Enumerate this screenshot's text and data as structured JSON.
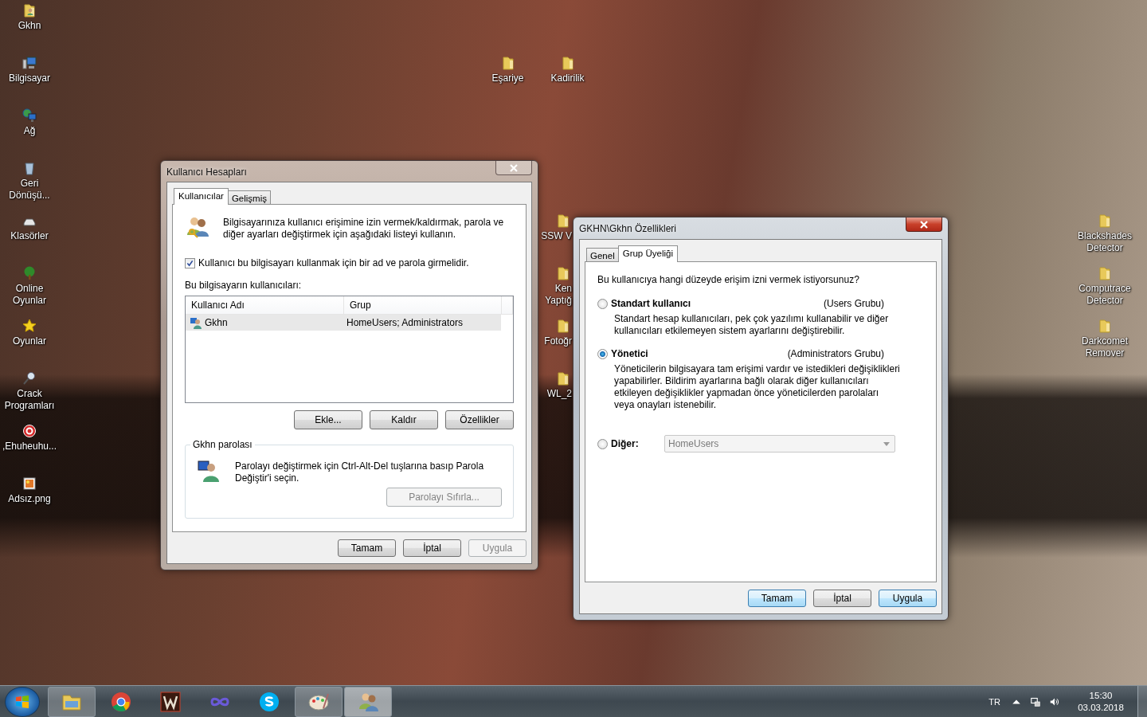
{
  "desktop": {
    "left_icons": [
      {
        "kind": "user-folder",
        "label": "Gkhn"
      },
      {
        "kind": "computer",
        "label": "Bilgisayar"
      },
      {
        "kind": "network",
        "label": "Ağ"
      },
      {
        "kind": "recycle-bin",
        "label": "Geri Dönüşü..."
      },
      {
        "kind": "drive",
        "label": "Klasörler"
      },
      {
        "kind": "tree",
        "label": "Online Oyunlar"
      },
      {
        "kind": "star",
        "label": "Oyunlar"
      },
      {
        "kind": "magnifier",
        "label": "Crack Programları"
      },
      {
        "kind": "red-badge",
        "label": ",Ehuheuhu..."
      },
      {
        "kind": "image",
        "label": "Adsız.png"
      }
    ],
    "top_icons": [
      {
        "kind": "folder",
        "label": "Eşariye"
      },
      {
        "kind": "folder",
        "label": "Kadirilik"
      }
    ],
    "partial_icons": [
      {
        "kind": "folder",
        "label": "SSW V"
      },
      {
        "kind": "folder",
        "label": "Ken Yaptığ"
      },
      {
        "kind": "folder",
        "label": "Fotoğr"
      },
      {
        "kind": "folder",
        "label": "WL_2"
      }
    ],
    "right_icons": [
      {
        "kind": "folder",
        "label": "Blackshades Detector"
      },
      {
        "kind": "folder",
        "label": "Computrace Detector"
      },
      {
        "kind": "folder",
        "label": "Darkcomet Remover"
      }
    ]
  },
  "users_window": {
    "title": "Kullanıcı Hesapları",
    "active": false,
    "tabs": [
      {
        "label": "Kullanıcılar",
        "selected": true
      },
      {
        "label": "Gelişmiş",
        "selected": false
      }
    ],
    "intro": "Bilgisayarınıza kullanıcı erişimine izin vermek/kaldırmak, parola ve diğer ayarları değiştirmek için aşağıdaki listeyi kullanın.",
    "require_password": {
      "label": "Kullanıcı bu bilgisayarı kullanmak için bir ad ve parola girmelidir.",
      "checked": true
    },
    "users_label": "Bu bilgisayarın kullanıcıları:",
    "columns": [
      "Kullanıcı Adı",
      "Grup"
    ],
    "rows": [
      {
        "name": "Gkhn",
        "group": "HomeUsers; Administrators",
        "selected": true
      }
    ],
    "list_buttons": [
      {
        "label": "Ekle...",
        "disabled": false
      },
      {
        "label": "Kaldır",
        "disabled": false
      },
      {
        "label": "Özellikler",
        "disabled": false
      }
    ],
    "password_group": {
      "title": "Gkhn parolası",
      "text": "Parolayı değiştirmek için Ctrl-Alt-Del tuşlarına basıp Parola Değiştir'i seçin.",
      "reset_button": {
        "label": "Parolayı Sıfırla...",
        "disabled": true
      }
    },
    "footer_buttons": [
      {
        "label": "Tamam",
        "disabled": false,
        "highlighted": false
      },
      {
        "label": "İptal",
        "disabled": false,
        "highlighted": false
      },
      {
        "label": "Uygula",
        "disabled": true,
        "highlighted": false
      }
    ]
  },
  "properties_window": {
    "title": "GKHN\\Gkhn Özellikleri",
    "active": true,
    "tabs": [
      {
        "label": "Genel",
        "selected": false
      },
      {
        "label": "Grup Üyeliği",
        "selected": true
      }
    ],
    "question": "Bu kullanıcıya hangi düzeyde erişim izni vermek istiyorsunuz?",
    "options": [
      {
        "kind": "level",
        "label": "Standart kullanıcı",
        "group": "(Users Grubu)",
        "description": "Standart hesap kullanıcıları, pek çok yazılımı kullanabilir ve diğer kullanıcıları etkilemeyen sistem ayarlarını değiştirebilir.",
        "selected": false
      },
      {
        "kind": "level",
        "label": "Yönetici",
        "group": "(Administrators Grubu)",
        "description": "Yöneticilerin bilgisayara tam erişimi vardır ve istedikleri değişiklikleri yapabilirler. Bildirim ayarlarına bağlı olarak diğer kullanıcıları etkileyen değişiklikler yapmadan önce yöneticilerden parolaları veya onayları istenebilir.",
        "selected": true
      },
      {
        "kind": "other",
        "label": "Diğer:",
        "value": "HomeUsers",
        "disabled": true,
        "selected": false
      }
    ],
    "footer_buttons": [
      {
        "label": "Tamam",
        "disabled": false,
        "highlighted": true
      },
      {
        "label": "İptal",
        "disabled": false,
        "highlighted": false
      },
      {
        "label": "Uygula",
        "disabled": false,
        "highlighted": true
      }
    ]
  },
  "taskbar": {
    "apps": [
      {
        "kind": "explorer",
        "running": true,
        "active": false
      },
      {
        "kind": "chrome",
        "running": false,
        "active": false
      },
      {
        "kind": "w-app",
        "running": false,
        "active": false
      },
      {
        "kind": "infinity",
        "running": false,
        "active": false
      },
      {
        "kind": "skype",
        "running": false,
        "active": false
      },
      {
        "kind": "paint",
        "running": true,
        "active": false
      },
      {
        "kind": "users",
        "running": true,
        "active": true
      }
    ],
    "language": "TR",
    "time": "15:30",
    "date": "03.03.2018"
  }
}
